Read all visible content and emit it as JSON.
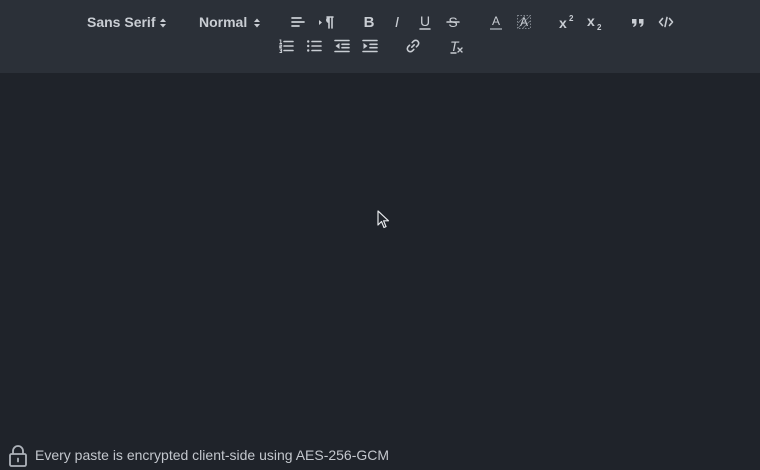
{
  "toolbar": {
    "font_picker": "Sans Serif",
    "size_picker": "Normal",
    "bold_glyph": "B",
    "italic_glyph": "I",
    "underline_glyph": "U",
    "strike_glyph": "S",
    "color_glyph": "A",
    "background_glyph": "A",
    "superscript_base": "x",
    "superscript_mark": "2",
    "subscript_base": "x",
    "subscript_mark": "2",
    "clean_glyph": "T"
  },
  "footer": {
    "encryption_notice": "Every paste is encrypted client-side using AES-256-GCM"
  },
  "colors": {
    "toolbar_bg": "#2b3038",
    "editor_bg": "#1f232a",
    "icon": "#c9cdd3"
  },
  "icons": {
    "align": "align-left-icon",
    "direction": "text-direction-icon",
    "blockquote": "quote-icon",
    "code": "code-block-icon",
    "ordered_list": "ordered-list-icon",
    "bullet_list": "bullet-list-icon",
    "indent_decrease": "outdent-icon",
    "indent_increase": "indent-icon",
    "link": "link-icon",
    "lock": "lock-icon"
  }
}
